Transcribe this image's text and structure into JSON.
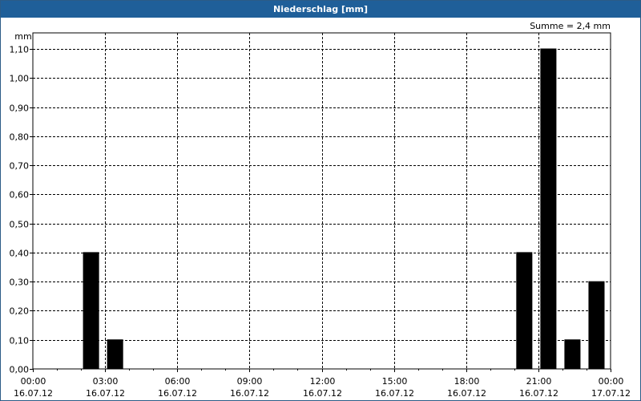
{
  "window": {
    "title": "Niederschlag [mm]"
  },
  "chart_data": {
    "type": "bar",
    "title": "Niederschlag [mm]",
    "ylabel": "mm",
    "summary": "Summe = 2,4 mm",
    "ylim": [
      0,
      1.1
    ],
    "y_ticks": [
      "0,00",
      "0,10",
      "0,20",
      "0,30",
      "0,40",
      "0,50",
      "0,60",
      "0,70",
      "0,80",
      "0,90",
      "1,00",
      "1,10"
    ],
    "x_ticks": [
      {
        "time": "00:00",
        "date": "16.07.12"
      },
      {
        "time": "03:00",
        "date": "16.07.12"
      },
      {
        "time": "06:00",
        "date": "16.07.12"
      },
      {
        "time": "09:00",
        "date": "16.07.12"
      },
      {
        "time": "12:00",
        "date": "16.07.12"
      },
      {
        "time": "15:00",
        "date": "16.07.12"
      },
      {
        "time": "18:00",
        "date": "16.07.12"
      },
      {
        "time": "21:00",
        "date": "16.07.12"
      },
      {
        "time": "00:00",
        "date": "17.07.12"
      }
    ],
    "xlim_hours": [
      0,
      24
    ],
    "bars": [
      {
        "hour": 3.0,
        "value": 0.4
      },
      {
        "hour": 4.0,
        "value": 0.1
      },
      {
        "hour": 21.0,
        "value": 0.4
      },
      {
        "hour": 22.0,
        "value": 1.1
      },
      {
        "hour": 23.0,
        "value": 0.1
      },
      {
        "hour": 24.0,
        "value": 0.3
      }
    ],
    "bar_color": "#000000",
    "grid": true,
    "grid_style": "dashed"
  }
}
